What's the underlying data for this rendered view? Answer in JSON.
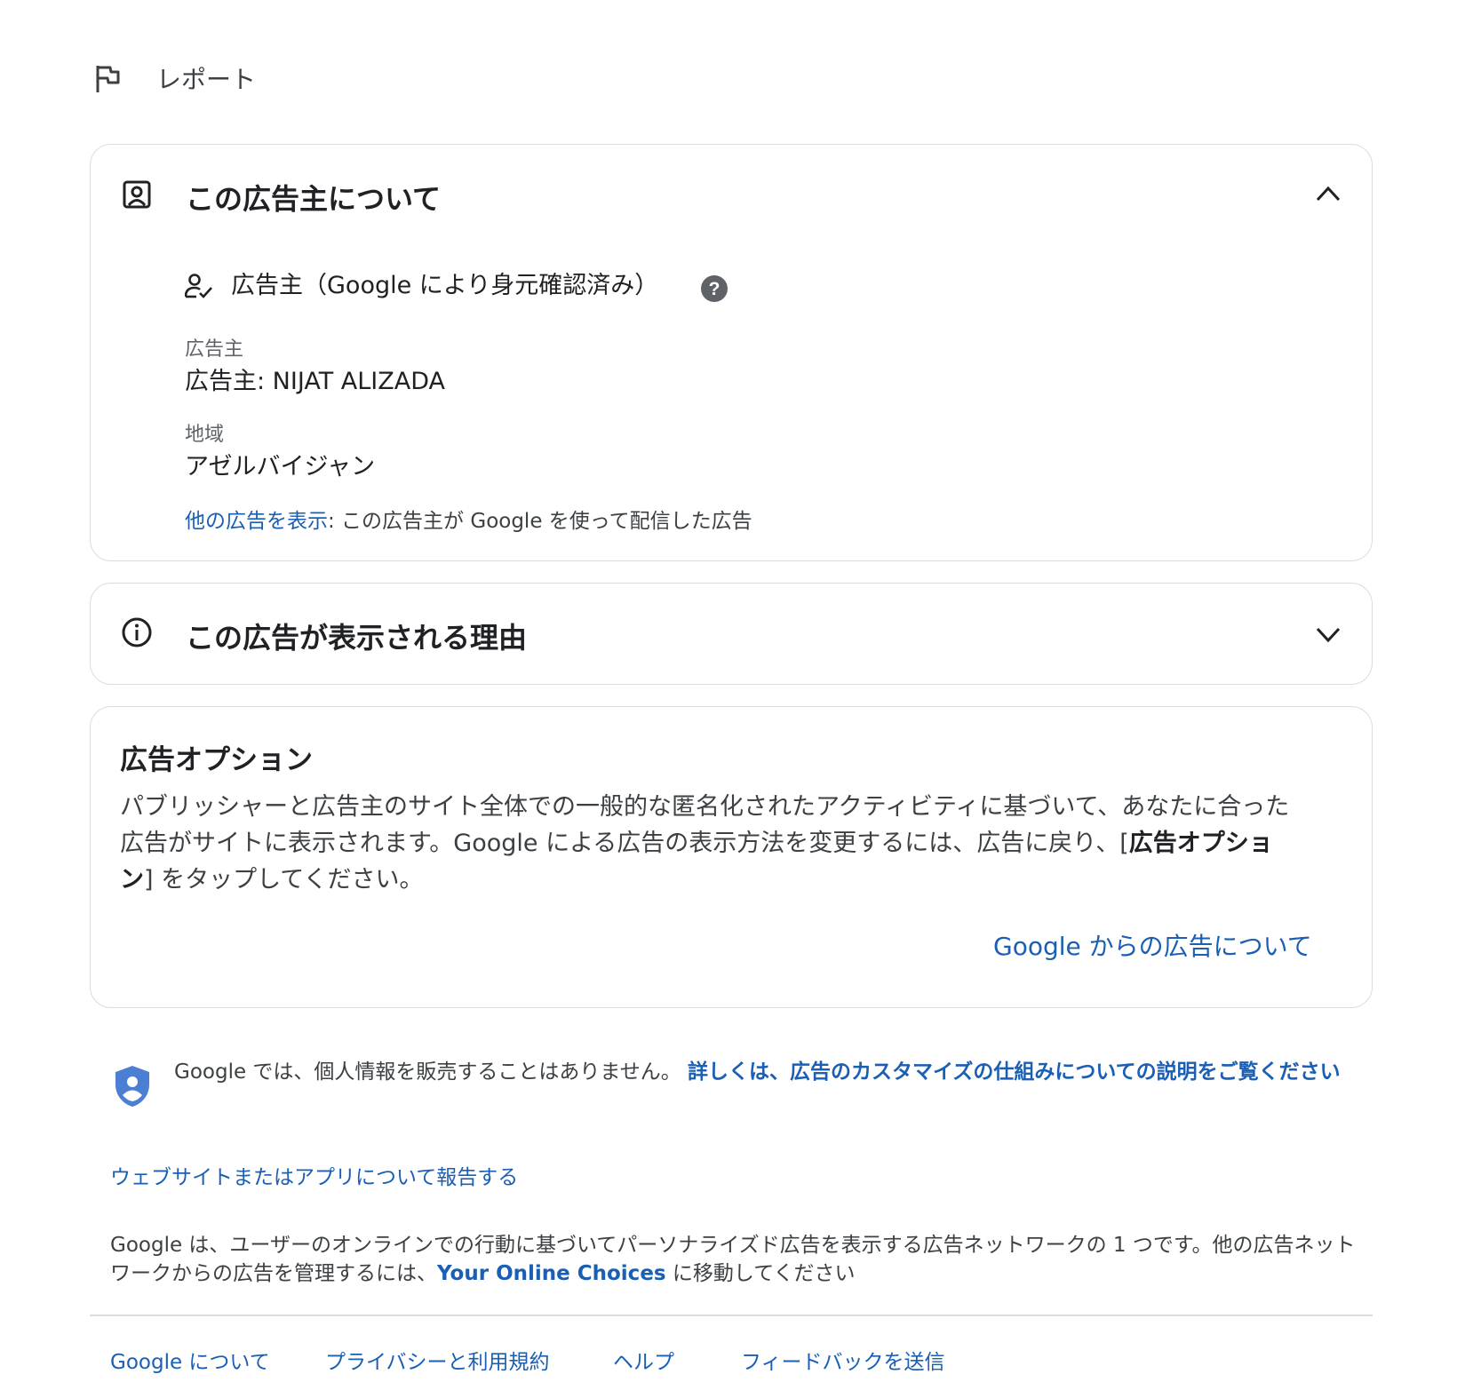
{
  "report": {
    "label": "レポート"
  },
  "advertiser_card": {
    "title": "この広告主について",
    "verified_label": "広告主（Google により身元確認済み）",
    "advertiser_field_label": "広告主",
    "advertiser_field_value": "広告主: NIJAT ALIZADA",
    "region_field_label": "地域",
    "region_field_value": "アゼルバイジャン",
    "other_ads_link": "他の広告を表示",
    "other_ads_text": ": この広告主が Google を使って配信した広告"
  },
  "reason_card": {
    "title": "この広告が表示される理由"
  },
  "options_card": {
    "title": "広告オプション",
    "body_start": "パブリッシャーと広告主のサイト全体での一般的な匿名化されたアクティビティに基づいて、あなたに合った広告がサイトに表示されます。Google による広告の表示方法を変更するには、広告に戻り、[",
    "body_bold": "広告オプション",
    "body_end": "] をタップしてください。",
    "about_link": "Google からの広告について"
  },
  "privacy": {
    "text": "Google では、個人情報を販売することはありません。",
    "link": "詳しくは、広告のカスタマイズの仕組みについての説明をご覧ください"
  },
  "report_site_link": "ウェブサイトまたはアプリについて報告する",
  "network": {
    "text_start": "Google は、ユーザーのオンラインでの行動に基づいてパーソナライズド広告を表示する広告ネットワークの 1 つです。他の広告ネットワークからの広告を管理するには、",
    "link": "Your Online Choices",
    "text_end": " に移動してください"
  },
  "footer": {
    "links": [
      "Google について",
      "プライバシーと利用規約",
      "ヘルプ",
      "フィードバックを送信"
    ]
  },
  "colors": {
    "link": "#1a5fb4",
    "border": "#dadce0",
    "shield": "#4a7fd4"
  }
}
